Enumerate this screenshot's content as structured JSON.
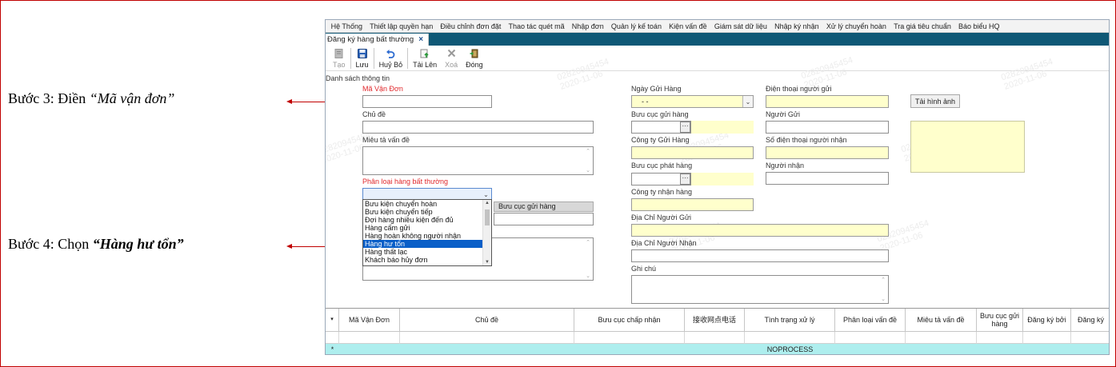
{
  "annotations": {
    "step3_prefix": "Bước 3: Điền ",
    "step3_emph": "“Mã vận đơn”",
    "step4_prefix": "Bước 4: Chọn ",
    "step4_emph": "“Hàng hư tổn”"
  },
  "menu": [
    "Hệ Thống",
    "Thiết lập quyền hạn",
    "Điều chỉnh đơn đặt",
    "Thao tác quét mã",
    "Nhập đơn",
    "Quản lý kế toán",
    "Kiện vấn đề",
    "Giám sát dữ liệu",
    "Nhập ký nhận",
    "Xử lý chuyển hoàn",
    "Tra giá tiêu chuẩn",
    "Báo biểu HQ"
  ],
  "tab": {
    "label": "Đăng ký hàng bất thường",
    "close": "×"
  },
  "toolbar": {
    "new": "Tạo",
    "save": "Lưu",
    "undo": "Huỷ Bỏ",
    "upload": "Tải Lên",
    "delete": "Xoá",
    "close": "Đóng"
  },
  "form": {
    "section": "Danh sách thông tin",
    "waybill": "Mã Vận Đơn",
    "subject": "Chủ đề",
    "description": "Miêu tả vấn đề",
    "classification": "Phân loại hàng bất thường",
    "send_date": "Ngày Gửi Hàng",
    "send_date_value": "- -",
    "sender_phone": "Điện thoại người gửi",
    "upload_image": "Tải hình ảnh",
    "send_post": "Bưu cục gửi hàng",
    "sender": "Người Gửi",
    "send_company": "Công ty Gửi Hàng",
    "receiver_phone": "Số điện thoại người nhận",
    "dispatch_post": "Bưu cục phát hàng",
    "receiver": "Người nhận",
    "receive_company": "Công ty nhận hàng",
    "sender_address": "Địa Chỉ Người Gửi",
    "receiver_address": "Địa Chỉ Người Nhận",
    "note": "Ghi chú",
    "mini_grid_header": "Bưu cục gửi hàng",
    "ellipsis": "···"
  },
  "dropdown": {
    "options": [
      "Bưu kiện chuyển hoàn",
      "Bưu kiện chuyển tiếp",
      "Đợi hàng nhiều kiện đến đủ",
      "Hàng cấm gửi",
      "Hàng hoàn không người nhận",
      "Hàng hư tổn",
      "Hàng thất lạc",
      "Khách báo hủy đơn"
    ],
    "selected_index": 5
  },
  "watermark": {
    "line1": "02820945454",
    "line2": "2020-11-06"
  },
  "grid": {
    "columns": [
      "Mã Vận Đơn",
      "Chủ đề",
      "Bưu cục chấp nhận",
      "接收网点电话",
      "Tình trạng xử lý",
      "Phân loại vấn đề",
      "Miêu tả vấn đề",
      "Bưu cục gửi hàng",
      "Đăng ký bởi",
      "Đăng ký"
    ],
    "new_row_marker": "*",
    "new_row_value": "NOPROCESS"
  },
  "colors": {
    "tab_strip": "#0f5876",
    "required_label": "#e0282c",
    "selected_option": "#0a5fc8",
    "new_row": "#aeeeee",
    "annotation_arrow": "#c00000",
    "yellow_field": "#ffffcc"
  },
  "icons": {
    "new": "document-icon",
    "save": "floppy-disk-icon",
    "undo": "undo-arrow-icon",
    "upload": "upload-icon",
    "delete": "x-mark-icon",
    "close": "exit-door-icon"
  }
}
